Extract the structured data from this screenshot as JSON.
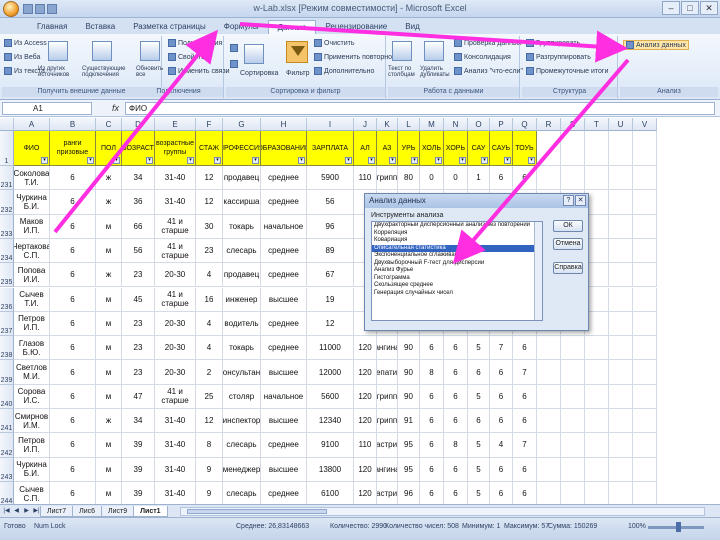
{
  "window": {
    "title": "w-Lab.xlsx [Режим совместимости] - Microsoft Excel",
    "controls": [
      "–",
      "□",
      "✕"
    ]
  },
  "ribbon_tabs": [
    "Главная",
    "Вставка",
    "Разметка страницы",
    "Формулы",
    "Данные",
    "Рецензирование",
    "Вид"
  ],
  "active_tab": "Данные",
  "ribbon": {
    "external": [
      "Из Access",
      "Из Веба",
      "Из текста",
      "Из других источников",
      "Существующие подключения",
      "Обновить все"
    ],
    "external_label": "Получить внешние данные",
    "connections": [
      "Подключения",
      "Свойства",
      "Изменить связи"
    ],
    "connections_label": "Подключения",
    "sort": [
      "Сортировка",
      "Фильтр",
      "Очистить",
      "Применить повторно",
      "Дополнительно"
    ],
    "sort_label": "Сортировка и фильтр",
    "tools": [
      "Текст по столбцам",
      "Удалить дубликаты",
      "Проверка данных",
      "Консолидация",
      "Анализ \"что-если\""
    ],
    "tools_label": "Работа с данными",
    "outline": [
      "Группировать",
      "Разгруппировать",
      "Промежуточные итоги"
    ],
    "outline_label": "Структура",
    "analysis": "Анализ данных",
    "analysis_label": "Анализ"
  },
  "formula_bar": {
    "cell": "A1",
    "fx": "fx",
    "value": "ФИО"
  },
  "columns": [
    "A",
    "B",
    "C",
    "D",
    "E",
    "F",
    "G",
    "H",
    "I",
    "J",
    "K",
    "L",
    "M",
    "N",
    "O",
    "P",
    "Q",
    "R",
    "S",
    "T",
    "U",
    "V"
  ],
  "header_row": [
    "ФИО",
    "ранги призовые",
    "ПОЛ",
    "ВОЗРАСТ",
    "возрастные группы",
    "СТАЖ",
    "ПРОФЕССИЯ",
    "ОБРАЗОВАНИЕ",
    "ЗАРПЛАТА",
    "АЛ",
    "АЗ",
    "УРЬ",
    "ХОЛЬ",
    "ХОРЬ",
    "САУ",
    "САУЬ",
    "ТОУЬ"
  ],
  "rows": [
    {
      "num": "231",
      "cells": [
        "Соколова Т.И.",
        "6",
        "ж",
        "34",
        "31-40",
        "12",
        "продавец",
        "среднее",
        "5900",
        "110",
        "грипп",
        "80",
        "0",
        "0",
        "1",
        "6",
        "6"
      ]
    },
    {
      "num": "232",
      "cells": [
        "Чуркина Б.И.",
        "6",
        "ж",
        "36",
        "31-40",
        "12",
        "кассирша",
        "среднее",
        "56",
        "",
        "",
        "",
        "",
        "",
        "",
        "",
        ""
      ]
    },
    {
      "num": "233",
      "cells": [
        "Маков И.П.",
        "6",
        "м",
        "66",
        "41 и старше",
        "30",
        "токарь",
        "начальное",
        "96",
        "",
        "",
        "",
        "",
        "",
        "",
        "",
        ""
      ]
    },
    {
      "num": "234",
      "cells": [
        "Чертакова С.П.",
        "6",
        "м",
        "56",
        "41 и старше",
        "23",
        "слесарь",
        "среднее",
        "89",
        "",
        "",
        "",
        "",
        "",
        "",
        "",
        ""
      ]
    },
    {
      "num": "235",
      "cells": [
        "Попова И.И.",
        "6",
        "ж",
        "23",
        "20-30",
        "4",
        "продавец",
        "среднее",
        "67",
        "",
        "",
        "",
        "",
        "",
        "",
        "",
        ""
      ]
    },
    {
      "num": "236",
      "cells": [
        "Сычев Т.И.",
        "6",
        "м",
        "45",
        "41 и старше",
        "16",
        "инженер",
        "высшее",
        "19",
        "",
        "",
        "",
        "",
        "",
        "",
        "",
        ""
      ]
    },
    {
      "num": "237",
      "cells": [
        "Петров И.П.",
        "6",
        "м",
        "23",
        "20-30",
        "4",
        "водитель",
        "среднее",
        "12",
        "",
        "",
        "",
        "",
        "",
        "",
        "",
        ""
      ]
    },
    {
      "num": "238",
      "cells": [
        "Глазов Б.Ю.",
        "6",
        "м",
        "23",
        "20-30",
        "4",
        "токарь",
        "среднее",
        "11000",
        "120",
        "ангина",
        "90",
        "6",
        "6",
        "5",
        "7",
        "6"
      ]
    },
    {
      "num": "239",
      "cells": [
        "Светлов М.И.",
        "6",
        "м",
        "23",
        "20-30",
        "2",
        "консультант",
        "высшее",
        "12000",
        "120",
        "гепатит",
        "90",
        "8",
        "6",
        "6",
        "6",
        "7"
      ]
    },
    {
      "num": "240",
      "cells": [
        "Сорова И.С.",
        "6",
        "м",
        "47",
        "41 и старше",
        "25",
        "столяр",
        "начальное",
        "5600",
        "120",
        "грипп",
        "90",
        "6",
        "6",
        "5",
        "6",
        "6"
      ]
    },
    {
      "num": "241",
      "cells": [
        "Смирнов И.М.",
        "6",
        "ж",
        "34",
        "31-40",
        "12",
        "инспектор",
        "высшее",
        "12340",
        "120",
        "грипп",
        "91",
        "6",
        "6",
        "6",
        "6",
        "6"
      ]
    },
    {
      "num": "242",
      "cells": [
        "Петров И.П.",
        "6",
        "м",
        "39",
        "31-40",
        "8",
        "слесарь",
        "среднее",
        "9100",
        "110",
        "гастрит",
        "95",
        "6",
        "8",
        "5",
        "4",
        "7"
      ]
    },
    {
      "num": "243",
      "cells": [
        "Чуркина Б.И.",
        "6",
        "м",
        "39",
        "31-40",
        "9",
        "менеджер",
        "высшее",
        "13800",
        "120",
        "ангина",
        "95",
        "6",
        "6",
        "5",
        "6",
        "6"
      ]
    },
    {
      "num": "244",
      "cells": [
        "Сычев С.П.",
        "6",
        "м",
        "39",
        "31-40",
        "9",
        "слесарь",
        "среднее",
        "6100",
        "120",
        "гастрит",
        "96",
        "6",
        "6",
        "5",
        "6",
        "6"
      ]
    }
  ],
  "dialog": {
    "title": "Анализ данных",
    "label": "Инструменты анализа",
    "items": [
      "Двухфакторный дисперсионный анализ без повторений",
      "Корреляция",
      "Ковариация",
      "Описательная статистика",
      "Экспоненциальное сглаживание",
      "Двухвыборочный F-тест для дисперсии",
      "Анализ Фурье",
      "Гистограмма",
      "Скользящее среднее",
      "Генерация случайных чисел"
    ],
    "selected_index": 3,
    "buttons": [
      "ОК",
      "Отмена",
      "Справка"
    ]
  },
  "sheet_tabs": [
    "Лист7",
    "Лис6",
    "Лист9",
    "Лист1"
  ],
  "active_sheet": "Лист1",
  "status": {
    "mode": "Готово",
    "extra": "Num Lock",
    "average": "Среднее: 26,83148663",
    "count": "Количество: 2990",
    "numcount": "Количество чисел: 508",
    "min": "Минимум: 1",
    "max": "Максимум: 57",
    "sum": "Сумма: 150269",
    "zoom": "100%"
  },
  "colors": {
    "header_fill": "#ffff00",
    "annotation_arrow": "#ff2ee0",
    "selection": "#3164c0"
  }
}
